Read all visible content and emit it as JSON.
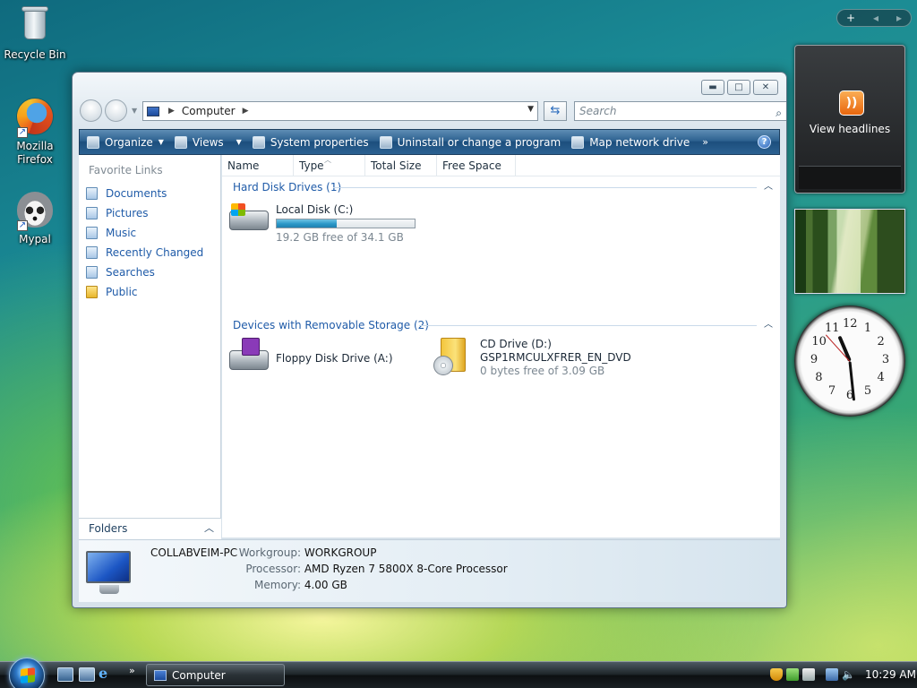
{
  "desktop": {
    "icons": [
      {
        "label": "Recycle Bin",
        "icon": "recycle-bin-icon"
      },
      {
        "label": "Mozilla Firefox",
        "icon": "firefox-icon"
      },
      {
        "label": "Mypal",
        "icon": "mypal-icon"
      }
    ]
  },
  "window": {
    "address": {
      "location": "Computer"
    },
    "search": {
      "placeholder": "Search"
    },
    "toolbar": {
      "organize": "Organize",
      "views": "Views",
      "system_properties": "System properties",
      "uninstall": "Uninstall or change a program",
      "map_drive": "Map network drive",
      "more": "»"
    },
    "favorites": {
      "title": "Favorite Links",
      "items": [
        {
          "label": "Documents",
          "icon": "documents-icon"
        },
        {
          "label": "Pictures",
          "icon": "pictures-icon"
        },
        {
          "label": "Music",
          "icon": "music-icon"
        },
        {
          "label": "Recently Changed",
          "icon": "recently-changed-icon"
        },
        {
          "label": "Searches",
          "icon": "searches-icon"
        },
        {
          "label": "Public",
          "icon": "public-folder-icon"
        }
      ],
      "folders_label": "Folders"
    },
    "columns": [
      "Name",
      "Type",
      "Total Size",
      "Free Space"
    ],
    "groups": [
      {
        "title": "Hard Disk Drives (1)"
      },
      {
        "title": "Devices with Removable Storage (2)"
      }
    ],
    "drives": {
      "c": {
        "name": "Local Disk (C:)",
        "free": "19.2 GB free of 34.1 GB",
        "used_fraction": 0.437
      },
      "a": {
        "name": "Floppy Disk Drive (A:)"
      },
      "d": {
        "name": "CD Drive (D:)",
        "label": "GSP1RMCULXFRER_EN_DVD",
        "free": "0 bytes free of 3.09 GB"
      }
    },
    "details": {
      "computer_name": "COLLABVEIM-PC",
      "workgroup_label": "Workgroup:",
      "workgroup": "WORKGROUP",
      "processor_label": "Processor:",
      "processor": "AMD Ryzen 7 5800X 8-Core Processor",
      "memory_label": "Memory:",
      "memory": "4.00 GB"
    }
  },
  "sidebar": {
    "feed_label": "View headlines",
    "clock_numbers": [
      "12",
      "1",
      "2",
      "3",
      "4",
      "5",
      "6",
      "7",
      "8",
      "9",
      "10",
      "11"
    ]
  },
  "taskbar": {
    "window_button": "Computer",
    "time": "10:29 AM",
    "more": "»"
  }
}
